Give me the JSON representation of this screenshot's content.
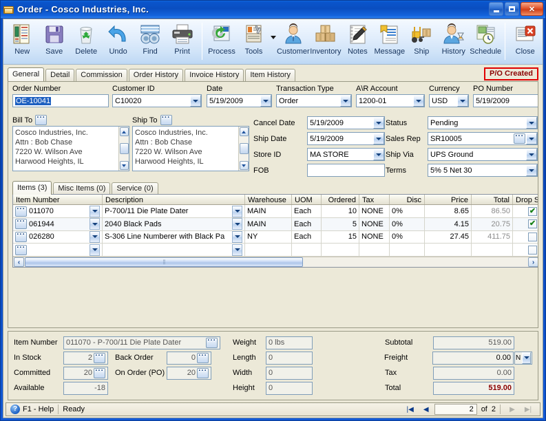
{
  "window": {
    "title": "Order - Cosco Industries, Inc.",
    "icon": "folder-icon",
    "minimize": "–",
    "maximize": "□",
    "close": "✕"
  },
  "toolbar": {
    "buttons": [
      {
        "label": "New",
        "icon": "new-document-icon"
      },
      {
        "label": "Save",
        "icon": "floppy-disk-icon"
      },
      {
        "label": "Delete",
        "icon": "recycle-bin-icon"
      },
      {
        "label": "Undo",
        "icon": "undo-arrow-icon"
      },
      {
        "label": "Find",
        "icon": "binoculars-icon"
      },
      {
        "label": "Print",
        "icon": "printer-icon"
      },
      {
        "label": "Process",
        "icon": "gear-refresh-icon"
      },
      {
        "label": "Tools",
        "icon": "tools-icon"
      },
      {
        "label": "Customer",
        "icon": "person-icon"
      },
      {
        "label": "Inventory",
        "icon": "boxes-icon"
      },
      {
        "label": "Notes",
        "icon": "notepad-pencil-icon"
      },
      {
        "label": "Message",
        "icon": "message-icon"
      },
      {
        "label": "Ship",
        "icon": "forklift-icon"
      },
      {
        "label": "History",
        "icon": "person-hourglass-icon"
      },
      {
        "label": "Schedule",
        "icon": "calendar-clock-icon"
      },
      {
        "label": "Close",
        "icon": "close-window-icon"
      }
    ]
  },
  "main_tabs": [
    {
      "label": "General",
      "active": true
    },
    {
      "label": "Detail",
      "active": false
    },
    {
      "label": "Commission",
      "active": false
    },
    {
      "label": "Order History",
      "active": false
    },
    {
      "label": "Invoice History",
      "active": false
    },
    {
      "label": "Item History",
      "active": false
    }
  ],
  "po_badge": "P/O Created",
  "header_fields": {
    "order_number": {
      "label": "Order Number",
      "value": "OE-10041",
      "selected": true
    },
    "customer_id": {
      "label": "Customer ID",
      "value": "C10020"
    },
    "date": {
      "label": "Date",
      "value": "5/19/2009"
    },
    "transaction_type": {
      "label": "Transaction Type",
      "value": "Order"
    },
    "ar_account": {
      "label": "A\\R Account",
      "value": "1200-01"
    },
    "currency": {
      "label": "Currency",
      "value": "USD"
    },
    "po_number": {
      "label": "PO Number",
      "value": "5/19/2009"
    }
  },
  "bill_to": {
    "label": "Bill To",
    "lines": [
      "Cosco Industries, Inc.",
      "Attn : Bob Chase",
      "7220 W. Wilson Ave",
      "Harwood Heights, IL"
    ]
  },
  "ship_to": {
    "label": "Ship To",
    "lines": [
      "Cosco Industries, Inc.",
      "Attn : Bob Chase",
      "7220 W. Wilson Ave",
      "Harwood Heights, IL"
    ]
  },
  "mid_fields": {
    "cancel_date": {
      "label": "Cancel Date",
      "value": "5/19/2009"
    },
    "ship_date": {
      "label": "Ship Date",
      "value": "5/19/2009"
    },
    "store_id": {
      "label": "Store ID",
      "value": "MA STORE"
    },
    "fob": {
      "label": "FOB",
      "value": ""
    },
    "status": {
      "label": "Status",
      "value": "Pending"
    },
    "sales_rep": {
      "label": "Sales Rep",
      "value": "SR10005"
    },
    "ship_via": {
      "label": "Ship Via",
      "value": "UPS Ground"
    },
    "terms": {
      "label": "Terms",
      "value": "5% 5 Net 30"
    }
  },
  "item_tabs": [
    {
      "label": "Items (3)",
      "active": true
    },
    {
      "label": "Misc Items (0)",
      "active": false
    },
    {
      "label": "Service (0)",
      "active": false
    }
  ],
  "grid": {
    "columns": [
      "Item Number",
      "Description",
      "Warehouse",
      "UOM",
      "Ordered",
      "Tax",
      "Disc",
      "Price",
      "Total",
      "Drop Ship"
    ],
    "rows": [
      {
        "item_number": "011070",
        "description": "P-700/11 Die Plate Dater",
        "warehouse": "MAIN",
        "uom": "Each",
        "ordered": "10",
        "tax": "NONE",
        "disc": "0%",
        "price": "8.65",
        "total": "86.50",
        "drop_ship": true
      },
      {
        "item_number": "061944",
        "description": "2040 Black Pads",
        "warehouse": "MAIN",
        "uom": "Each",
        "ordered": "5",
        "tax": "NONE",
        "disc": "0%",
        "price": "4.15",
        "total": "20.75",
        "drop_ship": true
      },
      {
        "item_number": "026280",
        "description": "S-306 Line Numberer with Black Pa",
        "warehouse": "NY",
        "uom": "Each",
        "ordered": "15",
        "tax": "NONE",
        "disc": "0%",
        "price": "27.45",
        "total": "411.75",
        "drop_ship": false
      },
      {
        "item_number": "",
        "description": "",
        "warehouse": "",
        "uom": "",
        "ordered": "",
        "tax": "",
        "disc": "",
        "price": "",
        "total": "",
        "drop_ship": false
      }
    ]
  },
  "detail": {
    "item_number": {
      "label": "Item Number",
      "value": "011070 - P-700/11 Die Plate Dater"
    },
    "in_stock": {
      "label": "In Stock",
      "value": "2"
    },
    "committed": {
      "label": "Committed",
      "value": "20"
    },
    "available": {
      "label": "Available",
      "value": "-18"
    },
    "back_order": {
      "label": "Back Order",
      "value": "0"
    },
    "on_order_po": {
      "label": "On Order (PO)",
      "value": "20"
    },
    "weight": {
      "label": "Weight",
      "value": "0 lbs"
    },
    "length": {
      "label": "Length",
      "value": "0"
    },
    "width": {
      "label": "Width",
      "value": "0"
    },
    "height": {
      "label": "Height",
      "value": "0"
    },
    "subtotal": {
      "label": "Subtotal",
      "value": "519.00"
    },
    "freight": {
      "label": "Freight",
      "value": "0.00",
      "taxable": "N"
    },
    "tax": {
      "label": "Tax",
      "value": "0.00"
    },
    "total": {
      "label": "Total",
      "value": "519.00"
    }
  },
  "statusbar": {
    "help": "F1 - Help",
    "state": "Ready",
    "record": "2",
    "of_label": "of",
    "record_count": "2",
    "first": "|◀",
    "prev": "◀",
    "next": "▶",
    "last": "▶|"
  },
  "colors": {
    "title_blue": "#0a4ec4",
    "face": "#ece9d8",
    "field_border": "#7f9db9",
    "badge_red": "#e00000",
    "total_red": "#8b0000",
    "check_green": "#158015"
  }
}
